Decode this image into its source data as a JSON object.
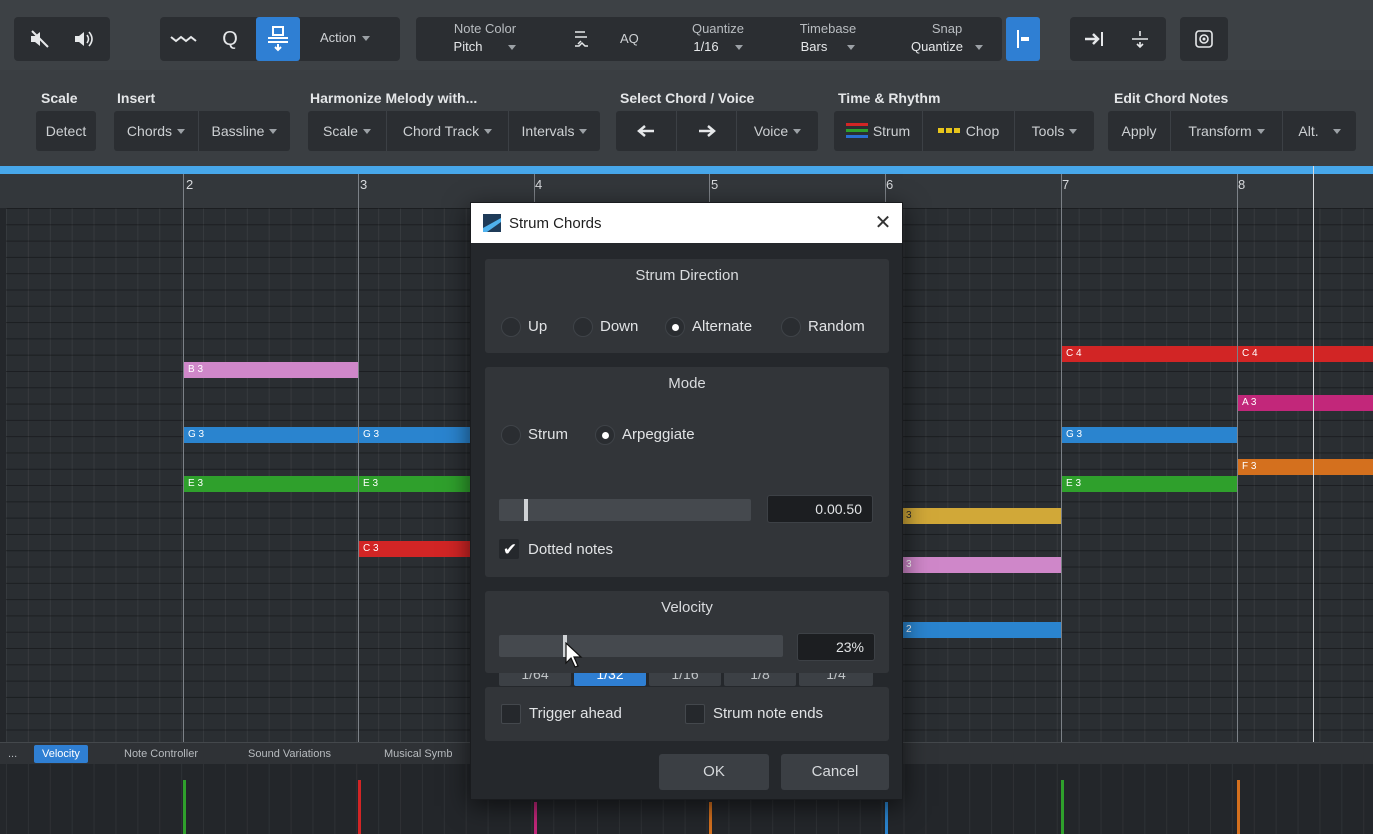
{
  "colors": {
    "accent": "#2f7fd3",
    "ruler_line": "#47a7ea",
    "note_pink": "#cf87c9",
    "note_blue": "#2a84cf",
    "note_green": "#2fa02c",
    "note_red": "#d22525",
    "note_magenta": "#c2277a",
    "note_orange": "#d4701e",
    "note_yellow": "#d1a838"
  },
  "toolbar": {
    "mute_icon": "speaker-muted-icon",
    "speaker_icon": "speaker-icon",
    "wave_icon": "wave-icon",
    "quantize_q": "Q",
    "strum_tool_icon": "strum-tool-icon",
    "action_label": "Action",
    "note_color_title": "Note Color",
    "note_color_value": "Pitch",
    "aq_label": "AQ",
    "quantize_title": "Quantize",
    "quantize_value": "1/16",
    "timebase_title": "Timebase",
    "timebase_value": "Bars",
    "snap_title": "Snap",
    "snap_value": "Quantize"
  },
  "ribbon": {
    "scale": {
      "head": "Scale",
      "detect": "Detect"
    },
    "insert": {
      "head": "Insert",
      "chords": "Chords",
      "bassline": "Bassline"
    },
    "harmonize": {
      "head": "Harmonize Melody with...",
      "scale": "Scale",
      "chord_track": "Chord Track",
      "intervals": "Intervals"
    },
    "select": {
      "head": "Select Chord / Voice",
      "voice": "Voice"
    },
    "time": {
      "head": "Time & Rhythm",
      "strum": "Strum",
      "chop": "Chop",
      "tools": "Tools"
    },
    "edit": {
      "head": "Edit Chord Notes",
      "apply": "Apply",
      "transform": "Transform",
      "alt": "Alt."
    }
  },
  "ruler": {
    "bars": [
      "2",
      "3",
      "4",
      "5",
      "6",
      "7",
      "8"
    ]
  },
  "notes": {
    "b3": "B 3",
    "g3": "G 3",
    "e3": "E 3",
    "c3": "C 3",
    "c4": "C 4",
    "a3": "A 3",
    "f3": "F 3",
    "partial_3": "3",
    "partial_2": "2"
  },
  "lanes": {
    "more": "...",
    "velocity": "Velocity",
    "note_controller": "Note Controller",
    "sound_variations": "Sound Variations",
    "musical_symbols": "Musical Symb"
  },
  "dialog": {
    "title": "Strum Chords",
    "strum_direction": {
      "title": "Strum Direction",
      "options": [
        "Up",
        "Down",
        "Alternate",
        "Random"
      ],
      "selected": "Alternate"
    },
    "mode": {
      "title": "Mode",
      "options": [
        "Strum",
        "Arpeggiate"
      ],
      "selected": "Arpeggiate",
      "divisions": [
        "1/64",
        "1/32",
        "1/16",
        "1/8",
        "1/4"
      ],
      "selected_division": "1/32",
      "time_value": "0.00.50",
      "dotted_label": "Dotted notes",
      "dotted_checked": true
    },
    "velocity": {
      "title": "Velocity",
      "value": "23%",
      "level": 0.23
    },
    "trigger_ahead": "Trigger ahead",
    "strum_note_ends": "Strum note ends",
    "ok": "OK",
    "cancel": "Cancel"
  }
}
